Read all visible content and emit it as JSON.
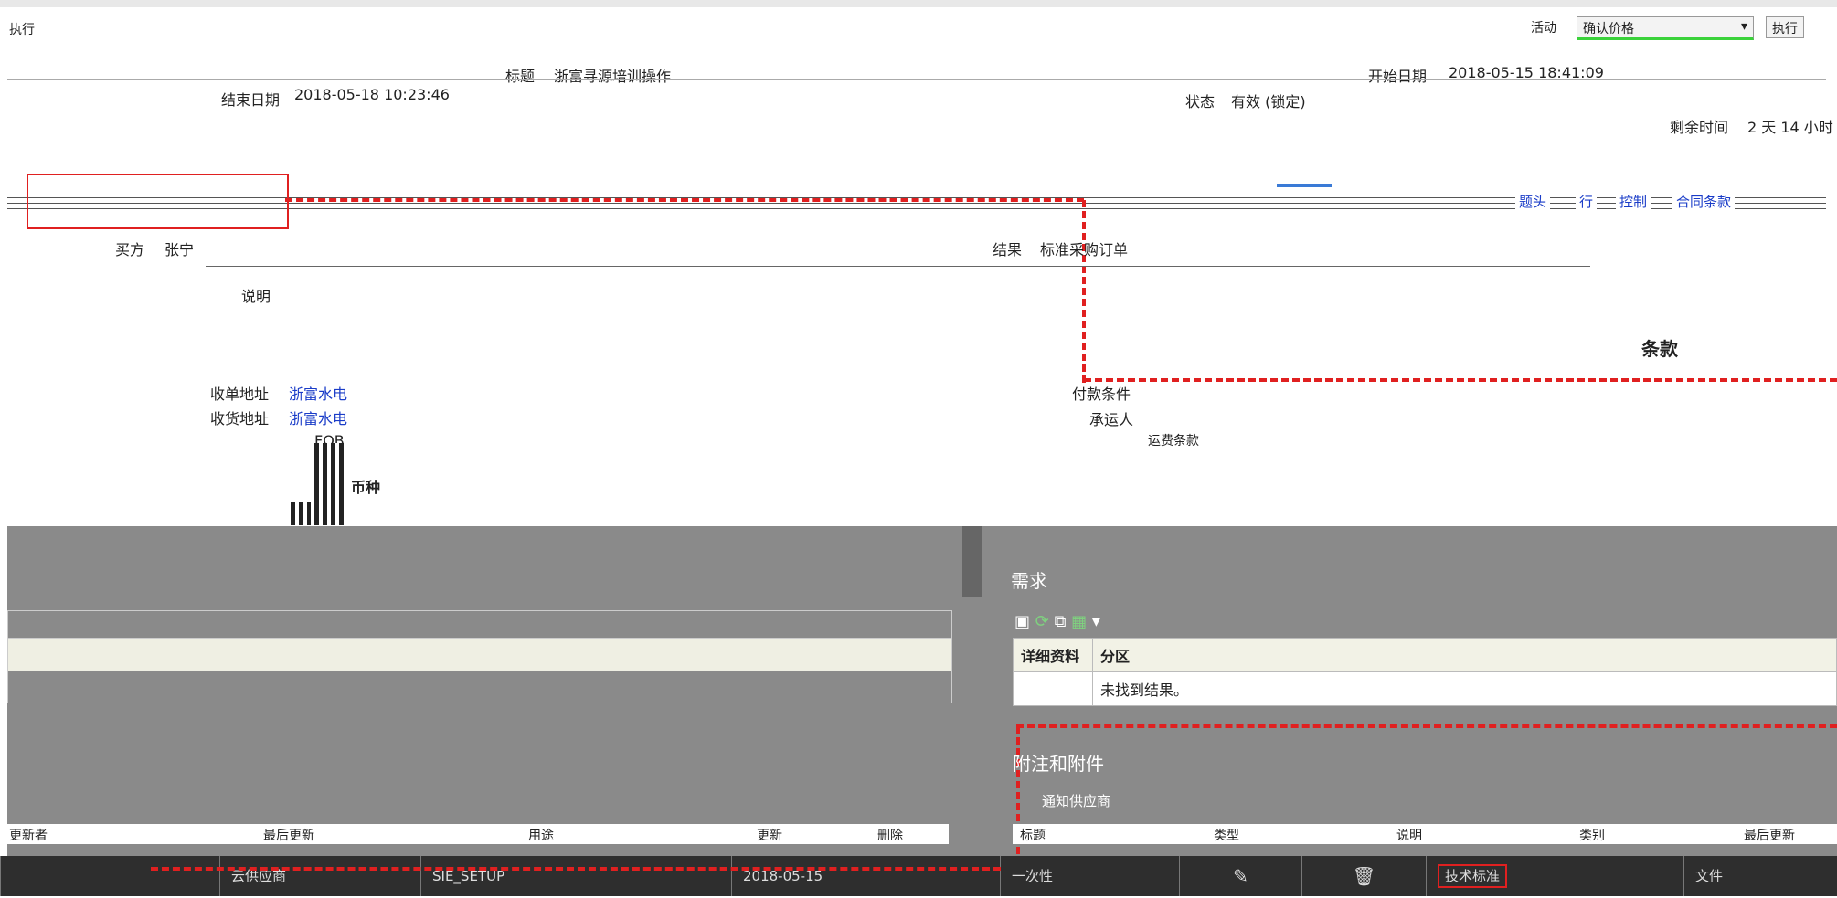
{
  "window": {
    "title": "执行"
  },
  "top_right": {
    "activity_label": "活动",
    "confirm_select": "确认价格",
    "go_button": "执行"
  },
  "header": {
    "title_label": "标题",
    "title_value": "浙富寻源培训操作",
    "start_label": "开始日期",
    "start_value": "2018-05-15 18:41:09",
    "end_label": "结束日期",
    "end_value": "2018-05-18 10:23:46",
    "status_label": "状态",
    "status_value": "有效 (锁定)",
    "remaining_label": "剩余时间",
    "remaining_value": "2 天 14 小时"
  },
  "tabs": [
    {
      "label": "题头"
    },
    {
      "label": "行"
    },
    {
      "label": "控制"
    },
    {
      "label": "合同条款"
    }
  ],
  "form": {
    "buyer_label": "买方",
    "buyer_value": "张宁",
    "result_label": "结果",
    "result_value": "标准采购订单",
    "desc_label": "说明",
    "bill_to_label": "收单地址",
    "bill_to_value": "浙富水电",
    "ship_to_label": "收货地址",
    "ship_to_value": "浙富水电",
    "payment_label": "付款条件",
    "carrier_label": "承运人",
    "freight_label": "运费条款",
    "fob_label": "FOB",
    "currency_label": "币种"
  },
  "terms": {
    "heading": "条款"
  },
  "requirements": {
    "heading": "需求",
    "columns": [
      "详细资料",
      "分区"
    ],
    "empty_text": "未找到结果。"
  },
  "attachments": {
    "heading": "附注和附件",
    "supplier_notice": "通知供应商",
    "columns": [
      "标题",
      "类型",
      "说明",
      "类别",
      "最后更新"
    ]
  },
  "left_table": {
    "columns": [
      "更新者",
      "最后更新",
      "用途",
      "更新",
      "删除"
    ]
  },
  "bottom_bar": {
    "cells": [
      "云供应商",
      "SIE_SETUP",
      "2018-05-15",
      "一次性",
      "",
      "",
      "技术标准",
      "文件"
    ],
    "icons": [
      "pencil-icon",
      "trash-icon"
    ]
  }
}
